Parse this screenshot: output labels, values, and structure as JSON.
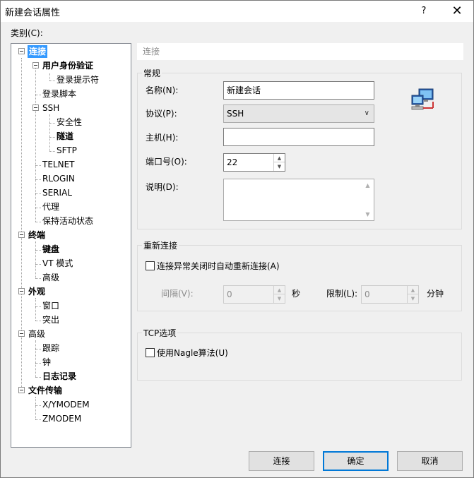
{
  "window": {
    "title": "新建会话属性",
    "help_label": "?",
    "close_label": "✕"
  },
  "category_label": "类别(C):",
  "tree": {
    "items": [
      {
        "label": "连接",
        "bold": true,
        "selected": true
      },
      {
        "label": "用户身份验证",
        "bold": true
      },
      {
        "label": "登录提示符"
      },
      {
        "label": "登录脚本"
      },
      {
        "label": "SSH"
      },
      {
        "label": "安全性"
      },
      {
        "label": "隧道",
        "bold": true
      },
      {
        "label": "SFTP"
      },
      {
        "label": "TELNET"
      },
      {
        "label": "RLOGIN"
      },
      {
        "label": "SERIAL"
      },
      {
        "label": "代理"
      },
      {
        "label": "保持活动状态"
      },
      {
        "label": "终端",
        "bold": true
      },
      {
        "label": "键盘",
        "bold": true
      },
      {
        "label": "VT 模式"
      },
      {
        "label": "高级"
      },
      {
        "label": "外观",
        "bold": true
      },
      {
        "label": "窗口"
      },
      {
        "label": "突出"
      },
      {
        "label": "高级"
      },
      {
        "label": "跟踪"
      },
      {
        "label": "钟"
      },
      {
        "label": "日志记录",
        "bold": true
      },
      {
        "label": "文件传输",
        "bold": true
      },
      {
        "label": "X/YMODEM"
      },
      {
        "label": "ZMODEM"
      }
    ]
  },
  "breadcrumb": "连接",
  "general": {
    "title": "常规",
    "name_label": "名称(N):",
    "name_value": "新建会话",
    "protocol_label": "协议(P):",
    "protocol_value": "SSH",
    "host_label": "主机(H):",
    "host_value": "",
    "port_label": "端口号(O):",
    "port_value": "22",
    "desc_label": "说明(D):",
    "desc_value": ""
  },
  "reconnect": {
    "title": "重新连接",
    "auto_label": "连接异常关闭时自动重新连接(A)",
    "auto_checked": false,
    "interval_label": "间隔(V):",
    "interval_value": "0",
    "interval_unit": "秒",
    "limit_label": "限制(L):",
    "limit_value": "0",
    "limit_unit": "分钟"
  },
  "tcp": {
    "title": "TCP选项",
    "nagle_label": "使用Nagle算法(U)",
    "nagle_checked": false
  },
  "buttons": {
    "connect": "连接",
    "ok": "确定",
    "cancel": "取消"
  },
  "icons": {
    "network": "network-computers-icon"
  }
}
